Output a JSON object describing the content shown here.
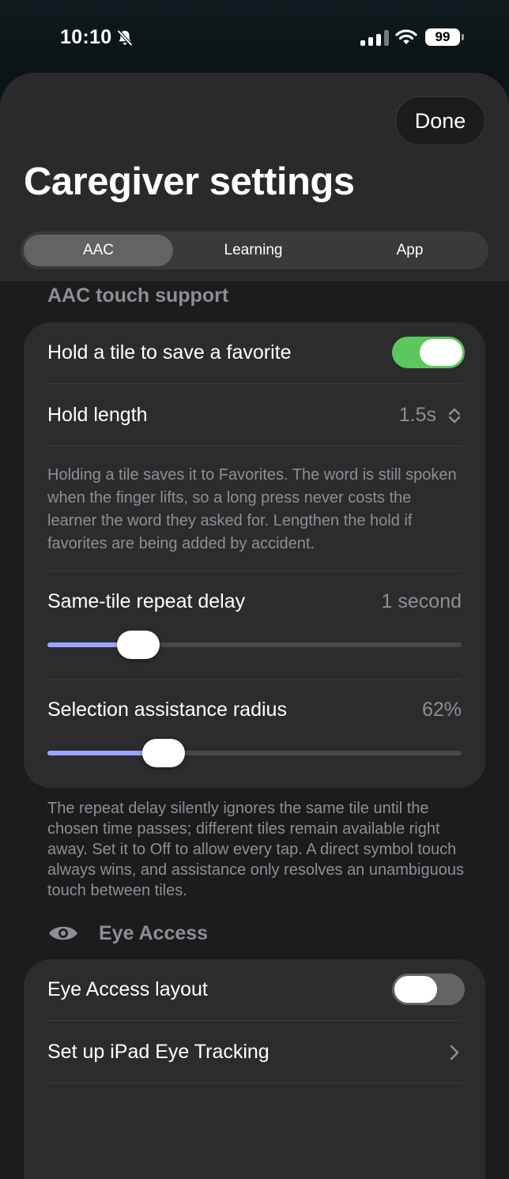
{
  "status_bar": {
    "time": "10:10",
    "silent_icon": "bell-slash-icon",
    "signal_icon": "cellular-signal-icon",
    "wifi_icon": "wifi-icon",
    "battery_level": "99"
  },
  "header": {
    "done_label": "Done",
    "title": "Caregiver settings",
    "tabs": [
      {
        "label": "AAC",
        "selected": true
      },
      {
        "label": "Learning",
        "selected": false
      },
      {
        "label": "App",
        "selected": false
      }
    ]
  },
  "aac_touch": {
    "section_title": "AAC touch support",
    "favorite_label": "Hold a tile to save a favorite",
    "favorite_on": true,
    "hold_length_label": "Hold length",
    "hold_length_value": "1.5s",
    "hold_note": "Holding a tile saves it to Favorites. The word is still spoken when the finger lifts, so a long press never costs the learner the word they asked for. Lengthen the hold if favorites are being added by accident.",
    "repeat_label": "Same-tile repeat delay",
    "repeat_value": "1 second",
    "repeat_slider_fraction": 0.22,
    "radius_label": "Selection assistance radius",
    "radius_value": "62%",
    "radius_slider_fraction": 0.28,
    "footnote": "The repeat delay silently ignores the same tile until the chosen time passes; different tiles remain available right away. Set it to Off to allow every tap. A direct symbol touch always wins, and assistance only resolves an unambiguous touch between tiles."
  },
  "eye_access": {
    "section_icon": "eye-icon",
    "section_title": "Eye Access",
    "layout_label": "Eye Access layout",
    "layout_on": false,
    "setup_label": "Set up iPad Eye Tracking"
  },
  "colors": {
    "toggle_on": "#5ac85f",
    "toggle_off": "#636366",
    "slider_fill": "#9aa6ff"
  }
}
